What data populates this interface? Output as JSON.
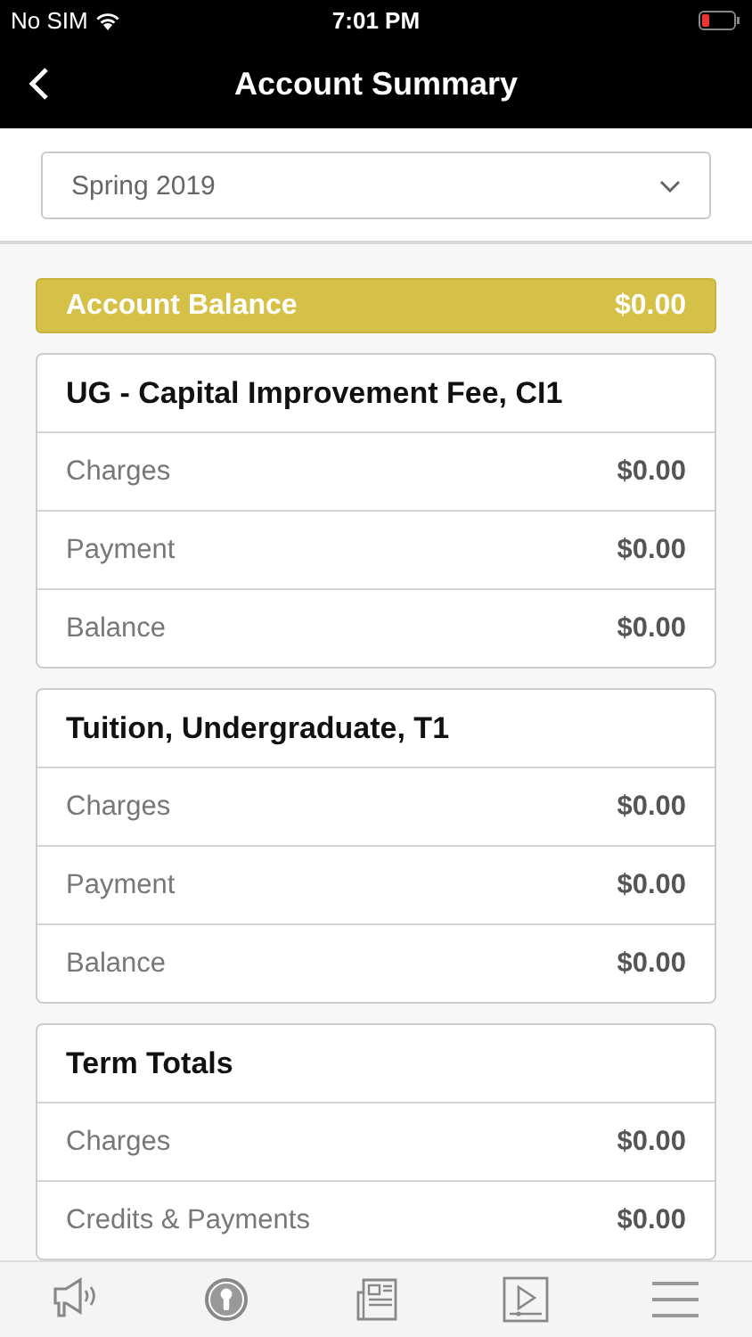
{
  "status_bar": {
    "carrier": "No SIM",
    "time": "7:01 PM"
  },
  "nav": {
    "title": "Account Summary"
  },
  "term_select": {
    "value": "Spring 2019"
  },
  "account_balance": {
    "label": "Account Balance",
    "amount": "$0.00"
  },
  "sections": [
    {
      "title": "UG - Capital Improvement Fee, CI1",
      "rows": [
        {
          "label": "Charges",
          "amount": "$0.00"
        },
        {
          "label": "Payment",
          "amount": "$0.00"
        },
        {
          "label": "Balance",
          "amount": "$0.00"
        }
      ]
    },
    {
      "title": "Tuition, Undergraduate, T1",
      "rows": [
        {
          "label": "Charges",
          "amount": "$0.00"
        },
        {
          "label": "Payment",
          "amount": "$0.00"
        },
        {
          "label": "Balance",
          "amount": "$0.00"
        }
      ]
    },
    {
      "title": "Term Totals",
      "rows": [
        {
          "label": "Charges",
          "amount": "$0.00"
        },
        {
          "label": "Credits & Payments",
          "amount": "$0.00"
        }
      ]
    }
  ]
}
